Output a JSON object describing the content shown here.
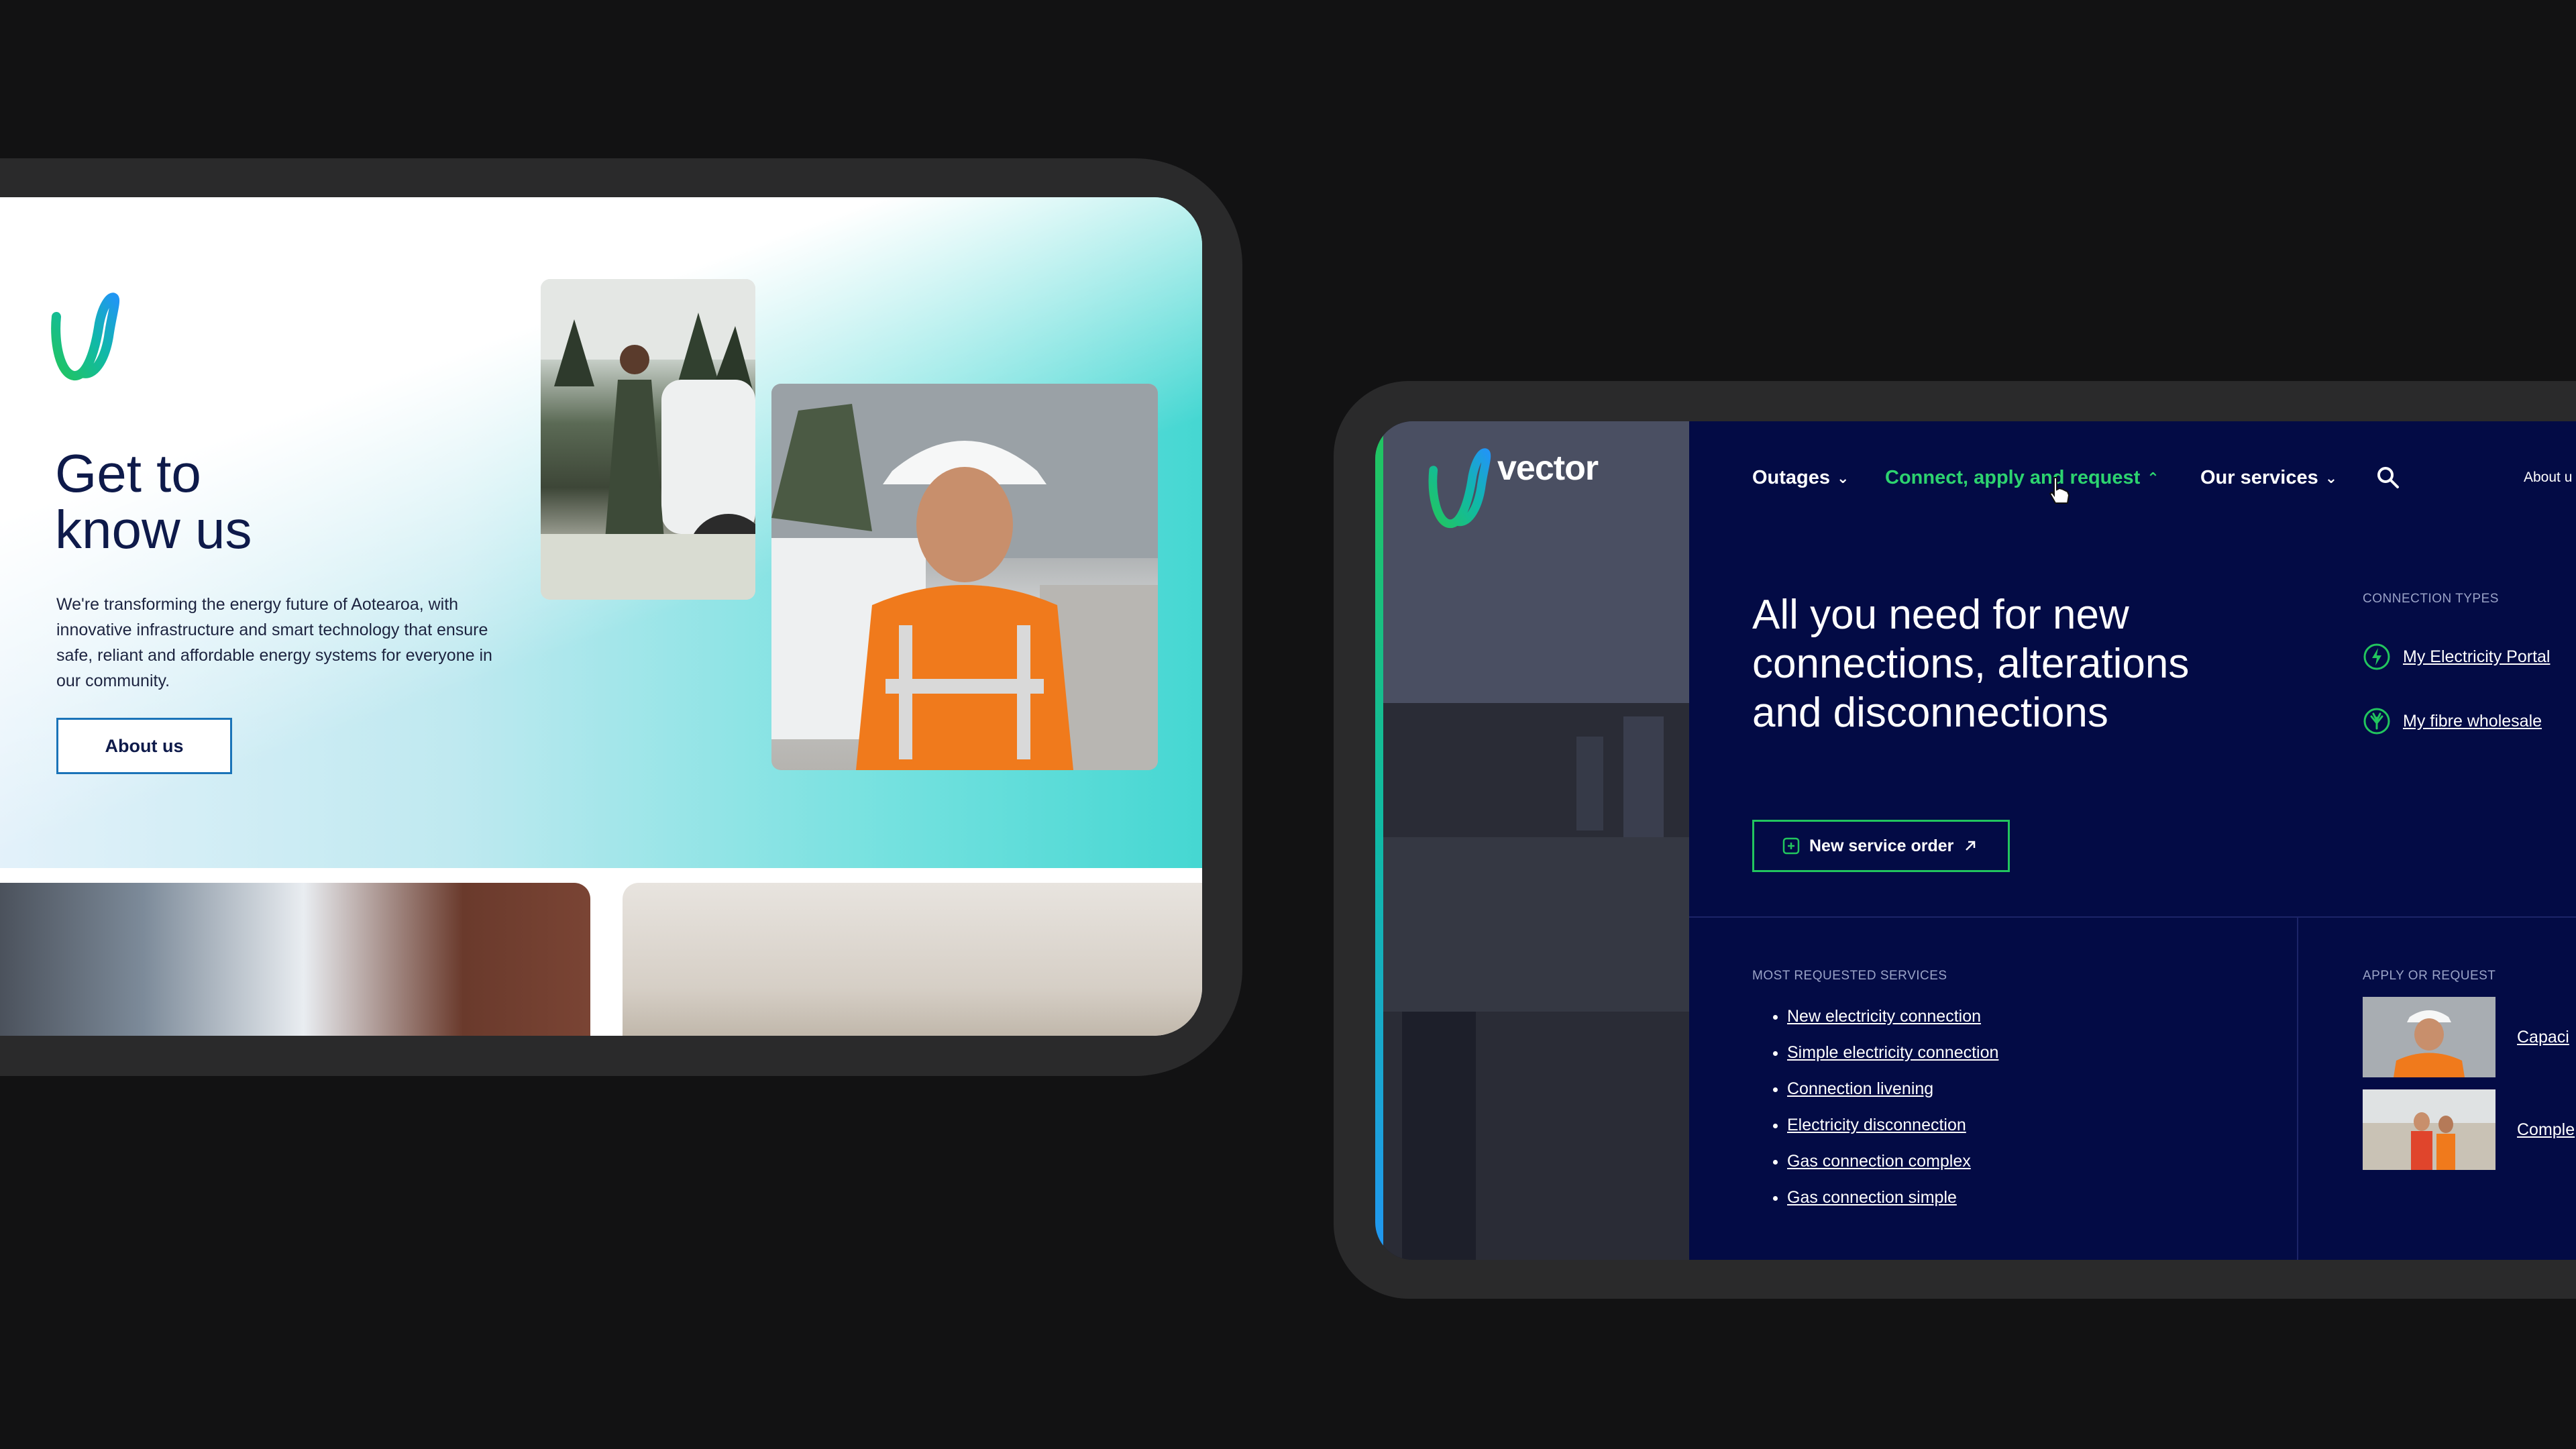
{
  "left_page": {
    "heading": "Get to\nknow us",
    "intro": "We're transforming the energy future of Aotearoa, with innovative infrastructure and smart technology that ensure safe, reliant and affordable energy systems for everyone in our community.",
    "about_button": "About us"
  },
  "right_page": {
    "brand": "vector",
    "nav": {
      "outages": "Outages",
      "connect": "Connect, apply and request",
      "services": "Our services",
      "about": "About u"
    },
    "heading": "All you need for new connections, alterations and disconnections",
    "new_order_button": "New service order",
    "connection_types": {
      "label": "CONNECTION TYPES",
      "links": [
        "My Electricity Portal",
        "My fibre wholesale"
      ]
    },
    "most_requested": {
      "label": "MOST REQUESTED SERVICES",
      "items": [
        "New electricity connection",
        "Simple electricity connection",
        "Connection livening",
        "Electricity disconnection",
        "Gas connection complex",
        "Gas connection simple"
      ]
    },
    "apply": {
      "label": "APPLY OR REQUEST",
      "items": [
        "Capaci",
        "Comple"
      ]
    }
  },
  "colors": {
    "navy": "#030b45",
    "accent_green": "#2dd36f",
    "outline_blue": "#1a73b8"
  }
}
